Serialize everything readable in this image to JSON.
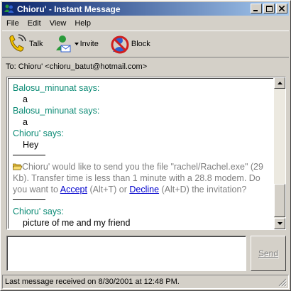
{
  "window": {
    "title": "Chioru' - Instant Message"
  },
  "menu": [
    "File",
    "Edit",
    "View",
    "Help"
  ],
  "toolbar": {
    "talk_label": "Talk",
    "invite_label": "Invite",
    "block_label": "Block"
  },
  "to_line": "To: Chioru' <chioru_batut@hotmail.com>",
  "chat": {
    "entries": [
      {
        "sender": "Balosu_minunat says:",
        "text": "a"
      },
      {
        "sender": "Balosu_minunat says:",
        "text": "a"
      },
      {
        "sender": "Chioru' says:",
        "text": "Hey"
      }
    ],
    "file_offer": {
      "intro": "Chioru' would like to send you the file \"rachel/Rachel.exe\" (29 Kb). Transfer time is less than 1 minute with a 28.8 modem. Do you want to",
      "accept": "Accept",
      "accept_key": "(Alt+T) or",
      "decline": "Decline",
      "decline_key": "(Alt+D) the invitation?"
    },
    "last_entry": {
      "sender": "Chioru' says:",
      "text": "picture of me and my friend"
    }
  },
  "compose": {
    "value": ""
  },
  "send_label": "Send",
  "status": "Last message received on 8/30/2001 at 12:48 PM.",
  "colors": {
    "title_start": "#0a246a",
    "title_end": "#a6caf0",
    "sender": "#0a8a74",
    "link": "#0000cc",
    "notice": "#808080"
  },
  "icons": [
    "msn-people-icon",
    "talk-phone-icon",
    "invite-person-icon",
    "block-icon",
    "folder-icon"
  ]
}
